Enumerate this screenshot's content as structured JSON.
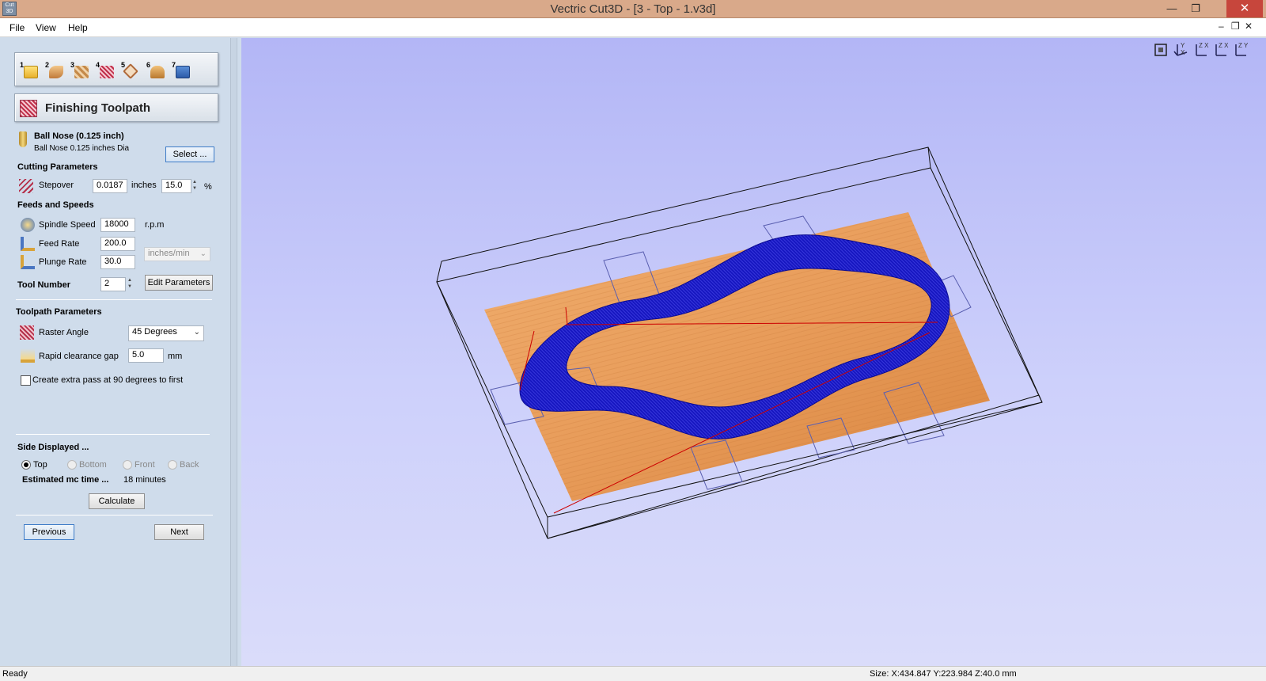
{
  "window": {
    "title": "Vectric Cut3D - [3 - Top - 1.v3d]",
    "app_icon_text": "Cut 3D",
    "minimize": "—",
    "restore": "❐",
    "close": "✕",
    "mdi_minimize": "–",
    "mdi_restore": "❐",
    "mdi_close": "✕"
  },
  "menu": {
    "file": "File",
    "view": "View",
    "help": "Help"
  },
  "steps": [
    "1",
    "2",
    "3",
    "4",
    "5",
    "6",
    "7"
  ],
  "panel": {
    "title": "Finishing Toolpath",
    "tool_name": "Ball Nose (0.125 inch)",
    "tool_desc": "Ball Nose 0.125 inches Dia",
    "select_label": "Select ...",
    "cutting_parameters": "Cutting Parameters",
    "stepover_label": "Stepover",
    "stepover_value": "0.0187",
    "stepover_unit": "inches",
    "stepover_pct": "15.0",
    "pct_sign": "%",
    "feeds_speeds": "Feeds and Speeds",
    "spindle_label": "Spindle Speed",
    "spindle_value": "18000",
    "spindle_unit": "r.p.m",
    "feed_label": "Feed Rate",
    "feed_value": "200.0",
    "plunge_label": "Plunge Rate",
    "plunge_value": "30.0",
    "rate_unit": "inches/min",
    "tool_number_label": "Tool Number",
    "tool_number_value": "2",
    "edit_parameters": "Edit Parameters",
    "toolpath_parameters": "Toolpath Parameters",
    "raster_label": "Raster Angle",
    "raster_value": "45 Degrees",
    "rapid_label": "Rapid clearance gap",
    "rapid_value": "5.0",
    "rapid_unit": "mm",
    "extra_pass_label": "Create extra pass at 90 degrees to first",
    "side_displayed": "Side Displayed ...",
    "side_top": "Top",
    "side_bottom": "Bottom",
    "side_front": "Front",
    "side_back": "Back",
    "est_time_label": "Estimated mc time ...",
    "est_time_value": "18 minutes",
    "calculate": "Calculate",
    "previous": "Previous",
    "next": "Next"
  },
  "view_icons": [
    "fit-view-icon",
    "iso-view-icon",
    "top-view-icon",
    "front-view-icon",
    "side-view-icon"
  ],
  "view_icon_labels": [
    "",
    "Y X",
    "Z X",
    "Z X",
    "Z Y"
  ],
  "status": {
    "ready": "Ready",
    "size": "Size: X:434.847 Y:223.984 Z:40.0 mm"
  },
  "colors": {
    "toolpath": "#1414b8",
    "material": "#e9a062",
    "box_lines": "#000000",
    "rapid_moves": "#cc0000",
    "title_bar": "#d9a98a"
  }
}
